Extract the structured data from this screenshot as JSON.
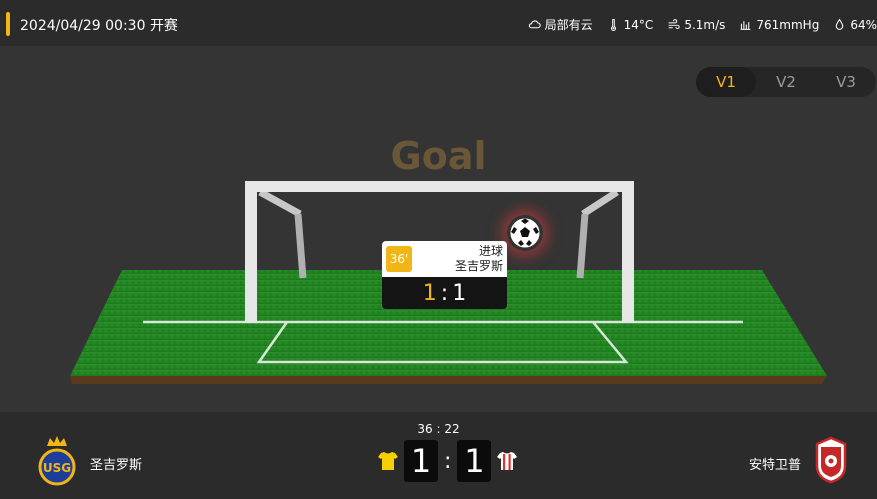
{
  "header": {
    "kickoff": "2024/04/29 00:30 开赛",
    "weather": {
      "condition": "局部有云",
      "temperature": "14°C",
      "wind": "5.1m/s",
      "pressure": "761mmHg",
      "humidity": "64%"
    }
  },
  "tabs": [
    {
      "label": "V1",
      "active": true
    },
    {
      "label": "V2",
      "active": false
    },
    {
      "label": "V3",
      "active": false
    }
  ],
  "stage": {
    "event_word": "Goal",
    "event_card": {
      "minute": "36'",
      "event_type": "进球",
      "team": "圣吉罗斯",
      "home_score": "1",
      "separator": ":",
      "away_score": "1"
    }
  },
  "scoreboard": {
    "clock": "36 : 22",
    "home_name": "圣吉罗斯",
    "away_name": "安特卫普",
    "home_score": "1",
    "separator": ":",
    "away_score": "1",
    "home_logo_text": "USG",
    "home_jersey_color": "#f5d000",
    "away_jersey_color": "#e03030"
  },
  "colors": {
    "accent": "#f2b516",
    "pitch_green": "#1f8a1f"
  }
}
